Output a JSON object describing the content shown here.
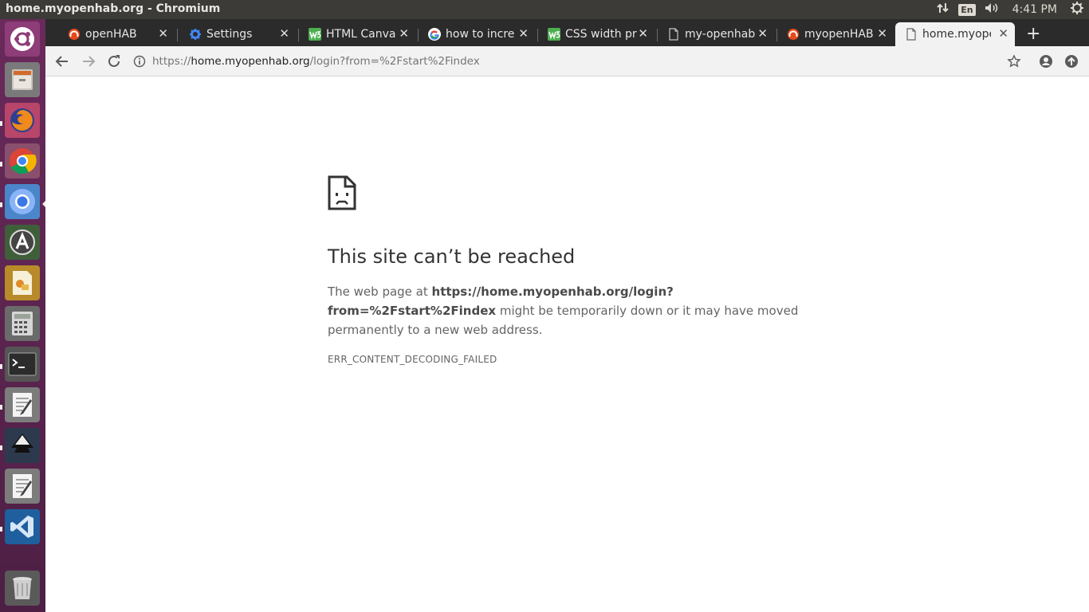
{
  "system": {
    "window_title": "home.myopenhab.org - Chromium",
    "keyboard_layout": "En",
    "clock": "4:41 PM"
  },
  "launcher": {
    "items": [
      {
        "name": "ubuntu-dash",
        "icon": "ubuntu-logo-icon"
      },
      {
        "name": "files",
        "icon": "file-cabinet-icon"
      },
      {
        "name": "firefox",
        "icon": "firefox-icon"
      },
      {
        "name": "chrome",
        "icon": "chrome-icon"
      },
      {
        "name": "chromium",
        "icon": "chromium-icon"
      },
      {
        "name": "software-updater",
        "icon": "software-updater-icon"
      },
      {
        "name": "impress",
        "icon": "presentation-icon"
      },
      {
        "name": "calculator",
        "icon": "calculator-icon"
      },
      {
        "name": "terminal",
        "icon": "terminal-icon"
      },
      {
        "name": "text-editor",
        "icon": "text-editor-icon"
      },
      {
        "name": "inkscape",
        "icon": "inkscape-icon"
      },
      {
        "name": "text-editor-2",
        "icon": "text-editor-icon"
      },
      {
        "name": "vscode",
        "icon": "vscode-icon"
      },
      {
        "name": "trash",
        "icon": "trash-icon"
      }
    ]
  },
  "tabs": [
    {
      "label": "openHAB",
      "icon": "openhab-icon"
    },
    {
      "label": "Settings",
      "icon": "gear-icon"
    },
    {
      "label": "HTML Canva",
      "icon": "w3-icon"
    },
    {
      "label": "how to incre",
      "icon": "google-icon"
    },
    {
      "label": "CSS width pr",
      "icon": "w3-icon"
    },
    {
      "label": "my-openhab",
      "icon": "page-icon"
    },
    {
      "label": "myopenHAB",
      "icon": "openhab-icon"
    },
    {
      "label": "home.myope",
      "icon": "page-icon",
      "active": true
    }
  ],
  "omnibox": {
    "scheme": "https://",
    "domain": "home.myopenhab.org",
    "path": "/login?from=%2Fstart%2Findex"
  },
  "error": {
    "title": "This site can’t be reached",
    "desc_prefix": "The web page at ",
    "url_bold": "https://home.myopenhab.org/login?from=%2Fstart%2Findex",
    "desc_suffix": " might be temporarily down or it may have moved permanently to a new web address.",
    "code": "ERR_CONTENT_DECODING_FAILED"
  },
  "colors": {
    "panel": "#3c3b37",
    "launcher": "#5e2750",
    "tab_strip": "#2b2b2b",
    "toolbar": "#f2f2f2"
  }
}
